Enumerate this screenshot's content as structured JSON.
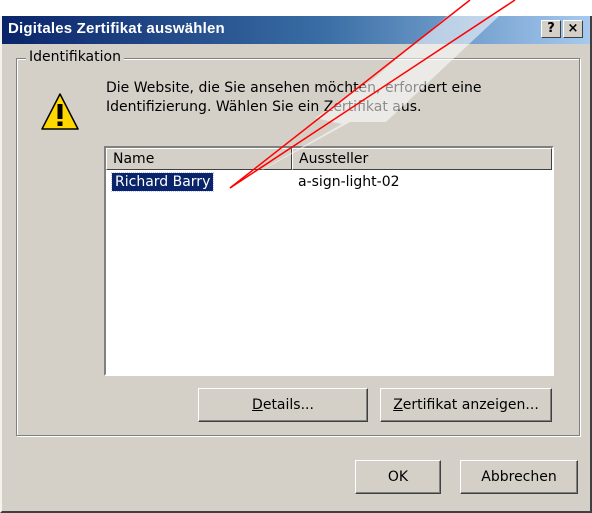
{
  "window": {
    "title": "Digitales Zertifikat auswählen",
    "help_glyph": "?",
    "close_glyph": "×"
  },
  "group": {
    "legend": "Identifikation"
  },
  "message": {
    "line1": "Die Website, die Sie ansehen möchten, erfordert eine",
    "line2": "Identifizierung. Wählen Sie ein Zertifikat aus."
  },
  "list": {
    "columns": [
      "Name",
      "Aussteller"
    ],
    "rows": [
      {
        "name": "Richard Barry",
        "issuer": "a-sign-light-02",
        "selected": true
      }
    ]
  },
  "buttons": {
    "details": {
      "accel": "D",
      "rest": "etails..."
    },
    "zertifikat": {
      "accel": "Z",
      "rest": "ertifikat anzeigen..."
    },
    "ok": "OK",
    "cancel": "Abbrechen"
  },
  "icons": {
    "warning": "warning-icon",
    "callout": "speech-callout"
  },
  "colors": {
    "titlebar_start": "#0a246a",
    "titlebar_end": "#a6caf0",
    "face": "#d4d0c8",
    "selection": "#0a246a",
    "callout_stroke": "#ff0000"
  }
}
